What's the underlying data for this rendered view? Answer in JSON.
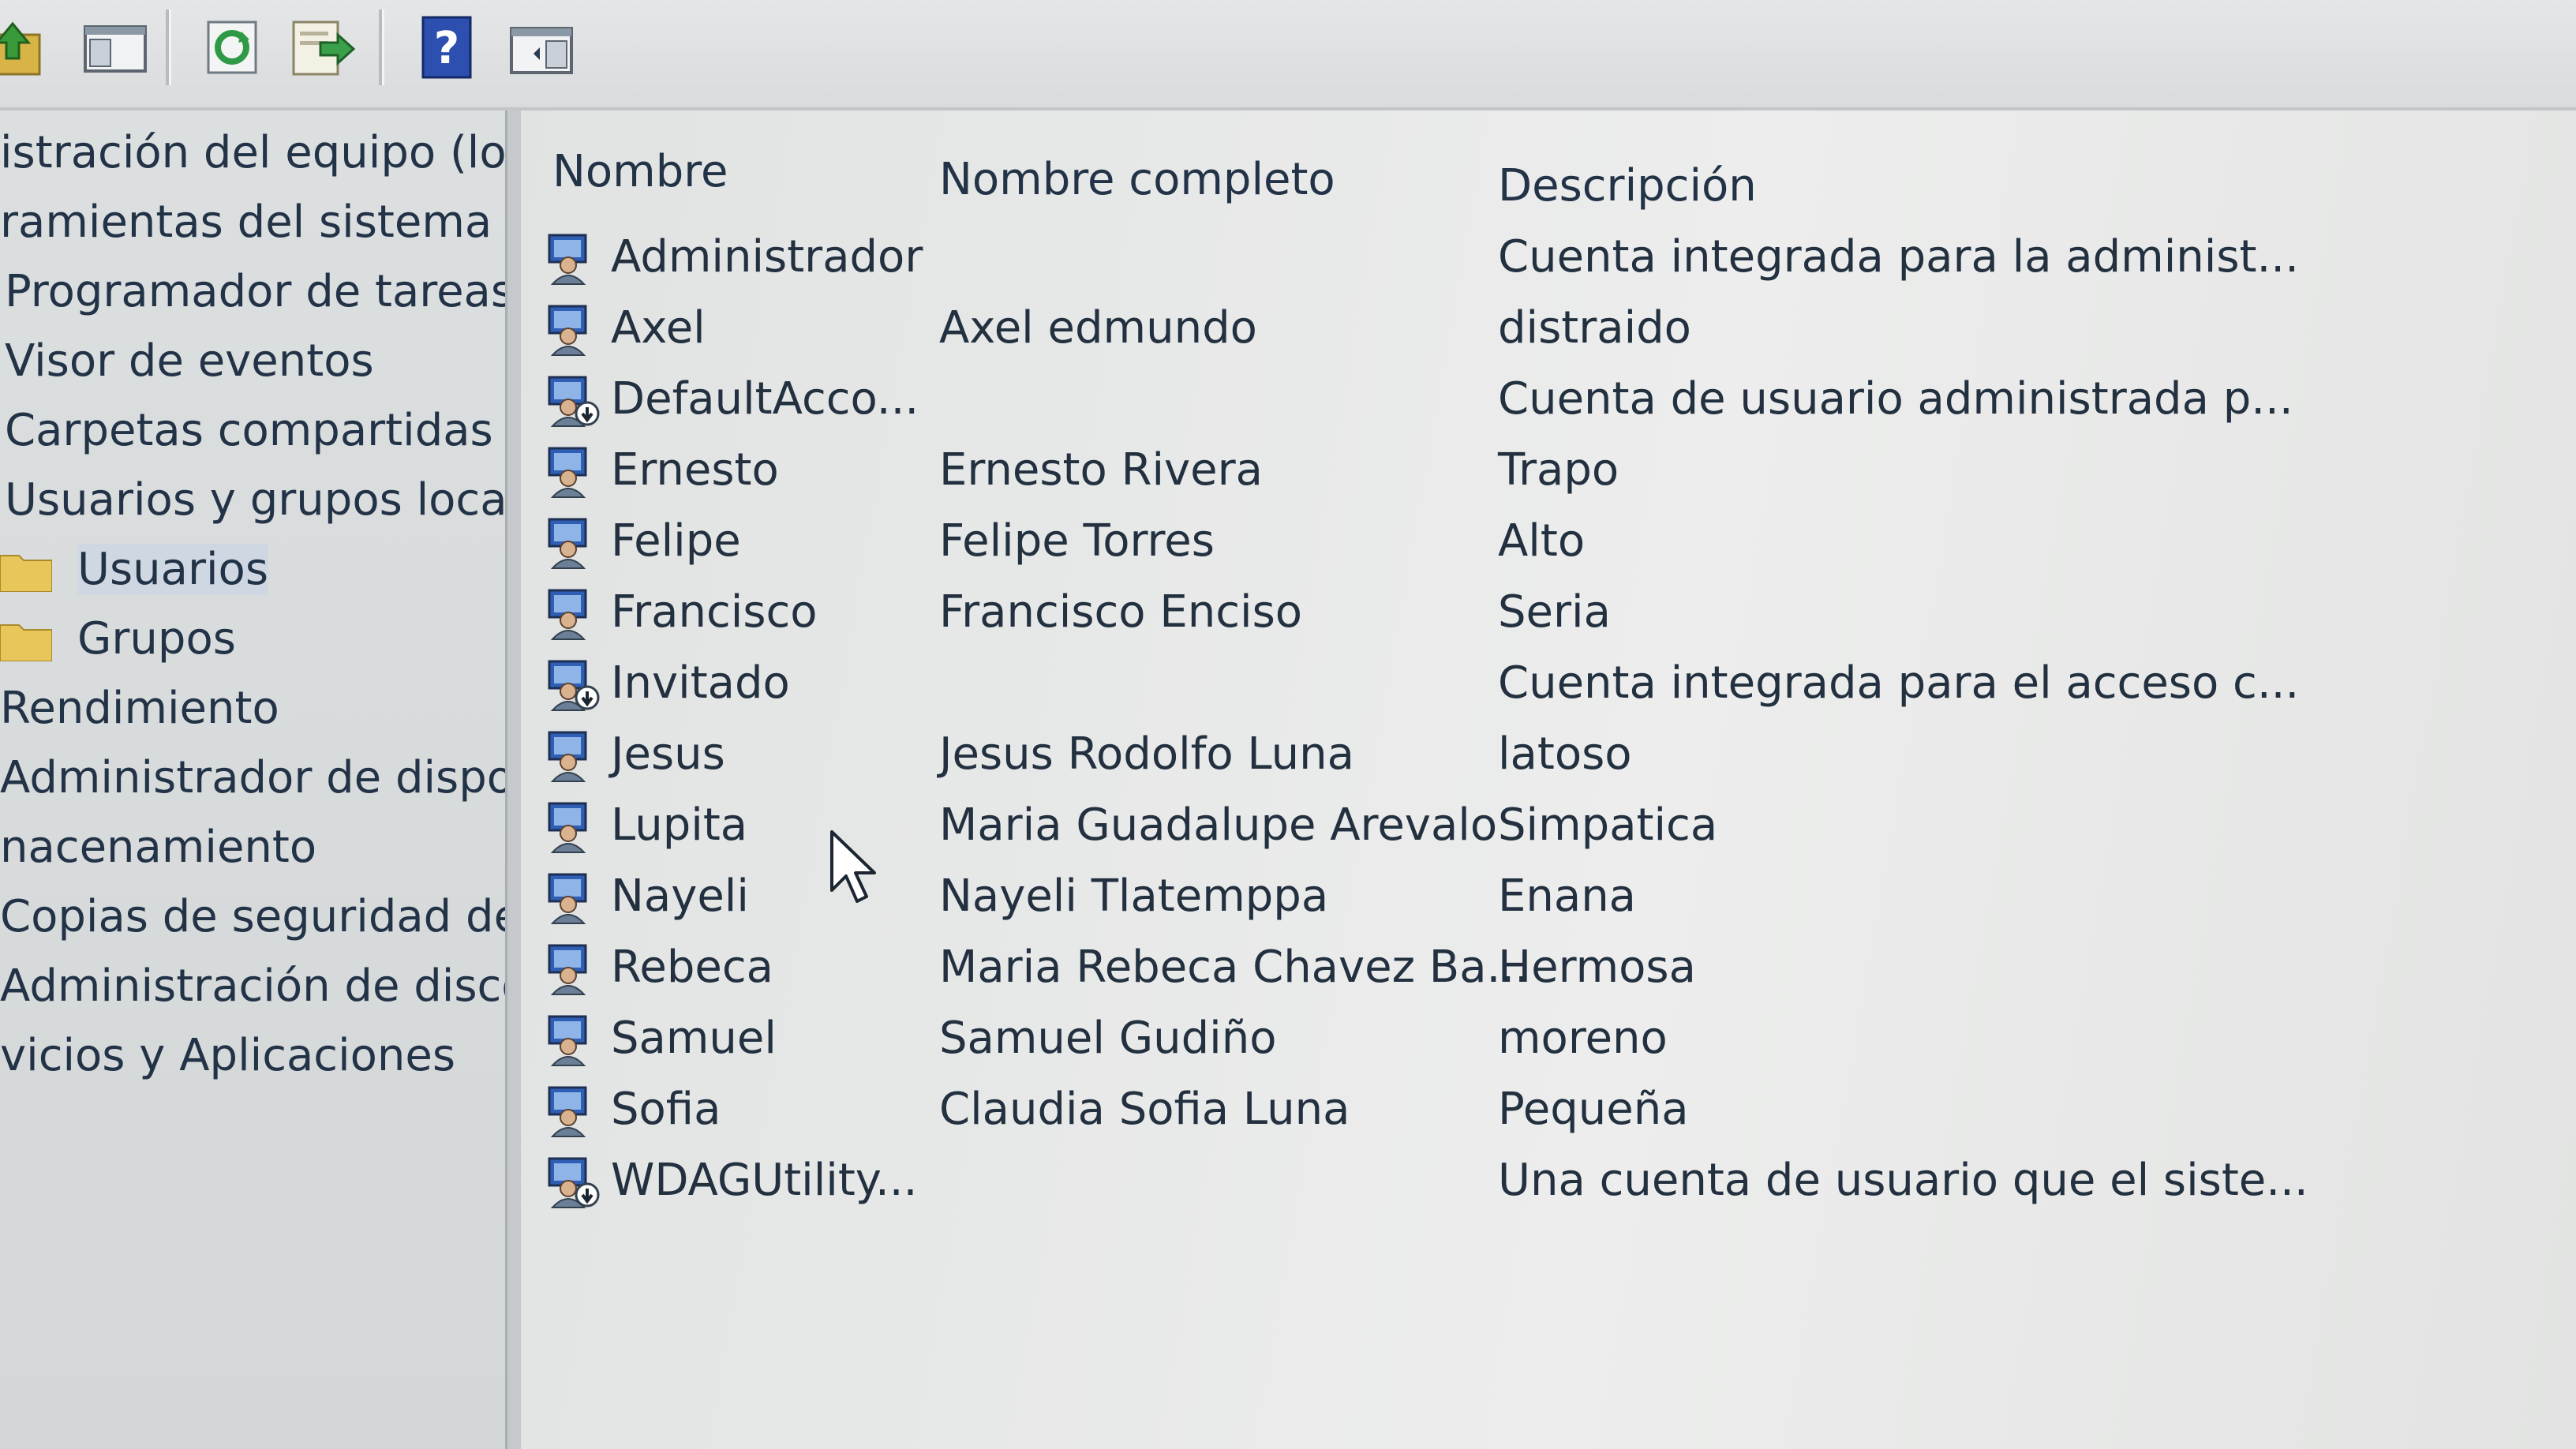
{
  "toolbar": {
    "buttons": [
      {
        "icon": "up-folder-icon"
      },
      {
        "icon": "show-hide-tree-icon"
      },
      {
        "icon": "refresh-icon"
      },
      {
        "icon": "export-list-icon"
      },
      {
        "icon": "help-icon"
      },
      {
        "icon": "show-hide-action-pane-icon"
      }
    ]
  },
  "tree": {
    "items": [
      {
        "label": "istración del equipo (loc"
      },
      {
        "label": "ramientas del sistema"
      },
      {
        "label": "Programador de tareas"
      },
      {
        "label": "Visor de eventos"
      },
      {
        "label": "Carpetas compartidas"
      },
      {
        "label": "Usuarios y grupos locale"
      },
      {
        "label": "Usuarios"
      },
      {
        "label": "Grupos"
      },
      {
        "label": "Rendimiento"
      },
      {
        "label": "Administrador de dispo"
      },
      {
        "label": "nacenamiento"
      },
      {
        "label": "Copias de seguridad de"
      },
      {
        "label": "Administración de disco"
      },
      {
        "label": "vicios y Aplicaciones"
      }
    ]
  },
  "list": {
    "columns": {
      "name": "Nombre",
      "full_name": "Nombre completo",
      "description": "Descripción"
    },
    "rows": [
      {
        "name": "Administrador",
        "full_name": "",
        "description": "Cuenta integrada para la administ...",
        "disabled": false
      },
      {
        "name": "Axel",
        "full_name": "Axel edmundo",
        "description": "distraido",
        "disabled": false
      },
      {
        "name": "DefaultAcco...",
        "full_name": "",
        "description": "Cuenta de usuario administrada p...",
        "disabled": true
      },
      {
        "name": "Ernesto",
        "full_name": "Ernesto Rivera",
        "description": "Trapo",
        "disabled": false
      },
      {
        "name": "Felipe",
        "full_name": "Felipe Torres",
        "description": "Alto",
        "disabled": false
      },
      {
        "name": "Francisco",
        "full_name": "Francisco Enciso",
        "description": "Seria",
        "disabled": false
      },
      {
        "name": "Invitado",
        "full_name": "",
        "description": "Cuenta integrada para el acceso c...",
        "disabled": true
      },
      {
        "name": "Jesus",
        "full_name": "Jesus Rodolfo Luna",
        "description": "latoso",
        "disabled": false
      },
      {
        "name": "Lupita",
        "full_name": "Maria Guadalupe Arevalo",
        "description": "Simpatica",
        "disabled": false
      },
      {
        "name": "Nayeli",
        "full_name": "Nayeli Tlatemppa",
        "description": "Enana",
        "disabled": false
      },
      {
        "name": "Rebeca",
        "full_name": "Maria Rebeca Chavez Ba...",
        "description": "Hermosa",
        "disabled": false
      },
      {
        "name": "Samuel",
        "full_name": "Samuel Gudiño",
        "description": "moreno",
        "disabled": false
      },
      {
        "name": "Sofia",
        "full_name": "Claudia Sofia Luna",
        "description": "Pequeña",
        "disabled": false
      },
      {
        "name": "WDAGUtility...",
        "full_name": "",
        "description": "Una cuenta de usuario que el siste...",
        "disabled": true
      }
    ]
  },
  "colors": {
    "text": "#22303f",
    "tree_text": "#233347",
    "folder": "#e8c65a",
    "user_icon_blue": "#2f5fb4",
    "user_icon_body": "#6b7f96"
  }
}
